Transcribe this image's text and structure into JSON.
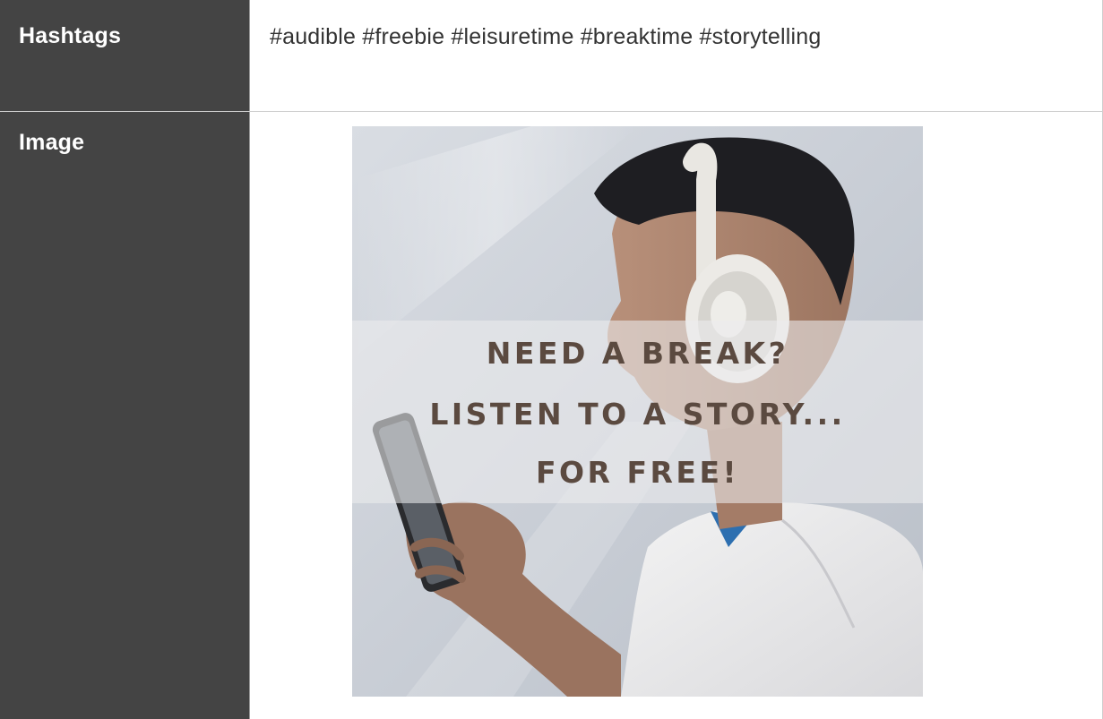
{
  "rows": [
    {
      "label": "Hashtags",
      "value": "#audible #freebie #leisuretime #breaktime #storytelling"
    },
    {
      "label": "Image"
    }
  ],
  "image": {
    "headline_lines": [
      "NEED A BREAK?",
      "LISTEN TO A STORY...",
      "FOR FREE!"
    ],
    "headline_color": "#5b4a40"
  },
  "colors": {
    "label_bg": "#444444",
    "label_text": "#ffffff",
    "value_text": "#333333"
  }
}
